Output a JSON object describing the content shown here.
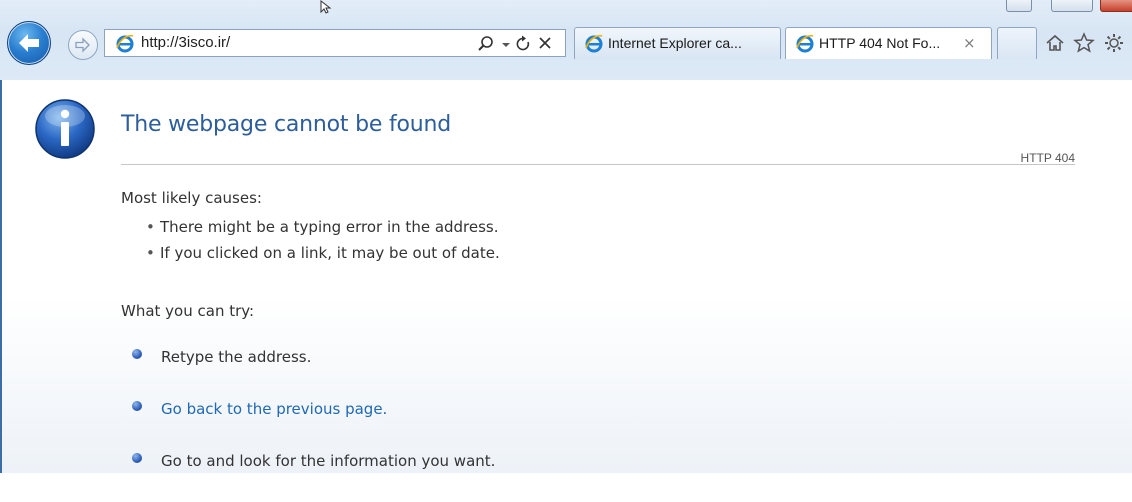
{
  "browser": {
    "address": {
      "url": "http://3isco.ir/"
    },
    "tabs": [
      {
        "title": "Internet Explorer ca...",
        "active": false
      },
      {
        "title": "HTTP 404 Not Fo...",
        "active": true,
        "close": "×"
      }
    ],
    "icons": {
      "back": "back-arrow-icon",
      "forward": "forward-arrow-icon",
      "search": "search-icon",
      "refresh": "refresh-icon",
      "stop": "stop-icon",
      "home": "home-icon",
      "favorites": "star-icon",
      "tools": "gear-icon"
    },
    "colors": {
      "chrome": "#dbe7f5",
      "back_button": "#2a7fd0",
      "close_button": "#c7402a"
    }
  },
  "page": {
    "title": "The webpage cannot be found",
    "http_code": "HTTP 404",
    "causes_heading": "Most likely causes:",
    "causes": [
      "There might be a typing error in the address.",
      "If you clicked on a link, it may be out of date."
    ],
    "try_heading": "What you can try:",
    "tries": [
      {
        "text": "Retype the address.",
        "link": false
      },
      {
        "text": "Go back to the previous page.",
        "link": true
      },
      {
        "text": "Go to  and look for the information you want.",
        "link": false
      }
    ],
    "colors": {
      "title": "#2d5d9b",
      "link": "#1f69b5",
      "text": "#333333"
    }
  }
}
